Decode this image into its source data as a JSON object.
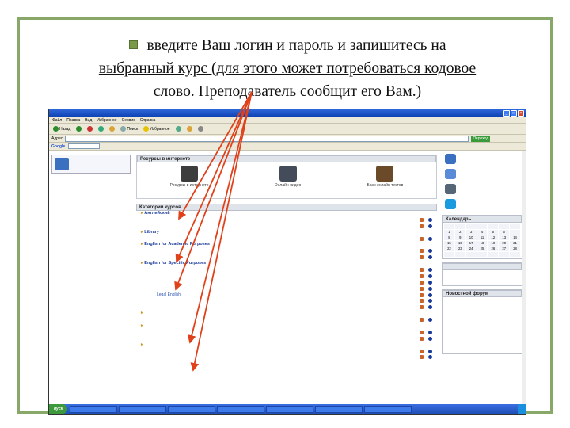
{
  "caption": {
    "line1": "введите Ваш логин и пароль и запишитесь на",
    "line2": "выбранный курс (для этого может потребоваться кодовое",
    "line3": "слово. Преподаватель сообщит его Вам.)"
  },
  "browser": {
    "menu": [
      "Файл",
      "Правка",
      "Вид",
      "Избранное",
      "Сервис",
      "Справка"
    ],
    "toolbar": [
      "Назад",
      "Поиск",
      "Избранное"
    ],
    "address_label": "Адрес",
    "go_label": "Переход",
    "google_label": "Google"
  },
  "page": {
    "resources_header": "Ресурсы в интернете",
    "resources": [
      {
        "label": "Ресурсы в интернете",
        "color": "#3d3d3d"
      },
      {
        "label": "Онлайн-видео",
        "color": "#444c5a"
      },
      {
        "label": "Банк онлайн тестов",
        "color": "#6b4a2a"
      }
    ],
    "categories_header": "Категории курсов",
    "category_rows": [
      {
        "text": "Английский",
        "kind": "cat"
      },
      {
        "text": "",
        "kind": "item"
      },
      {
        "text": "",
        "kind": "item"
      },
      {
        "text": "Library",
        "kind": "cat"
      },
      {
        "text": "",
        "kind": "item"
      },
      {
        "text": "English for Academic Purposes",
        "kind": "cat"
      },
      {
        "text": "",
        "kind": "item"
      },
      {
        "text": "",
        "kind": "item"
      },
      {
        "text": "English for Specific Purposes",
        "kind": "cat"
      },
      {
        "text": "",
        "kind": "item"
      },
      {
        "text": "",
        "kind": "item"
      },
      {
        "text": "",
        "kind": "item"
      },
      {
        "text": "",
        "kind": "item"
      },
      {
        "text": "Legal English",
        "kind": "item"
      },
      {
        "text": "",
        "kind": "item"
      },
      {
        "text": "",
        "kind": "item"
      },
      {
        "text": "",
        "kind": "cat"
      },
      {
        "text": "",
        "kind": "item"
      },
      {
        "text": "",
        "kind": "cat"
      },
      {
        "text": "",
        "kind": "item"
      },
      {
        "text": "",
        "kind": "item"
      },
      {
        "text": "",
        "kind": "cat"
      },
      {
        "text": "",
        "kind": "item"
      },
      {
        "text": "",
        "kind": "item"
      }
    ],
    "right_services": [
      {
        "label": "",
        "color": "#3b6fbf"
      },
      {
        "label": "",
        "color": "#5a8ad8"
      },
      {
        "label": "",
        "color": "#556677"
      },
      {
        "label": "",
        "color": "#1a9be0"
      }
    ],
    "calendar_header": "Календарь",
    "calendar_days": [
      "",
      "",
      "",
      "",
      "",
      "",
      "",
      "1",
      "2",
      "3",
      "4",
      "5",
      "6",
      "7",
      "8",
      "9",
      "10",
      "11",
      "12",
      "13",
      "14",
      "15",
      "16",
      "17",
      "18",
      "19",
      "20",
      "21",
      "22",
      "23",
      "24",
      "25",
      "26",
      "27",
      "28",
      "",
      "",
      "",
      "",
      "",
      "",
      ""
    ],
    "news_header": "",
    "forum_header": "Новостной форум",
    "forum_lines": [
      "",
      "",
      "",
      "",
      "",
      "",
      "",
      "",
      "",
      "",
      ""
    ]
  },
  "taskbar": {
    "start": "пуск",
    "buttons": [
      "",
      "",
      "",
      "",
      "",
      "",
      ""
    ],
    "clock": ""
  }
}
